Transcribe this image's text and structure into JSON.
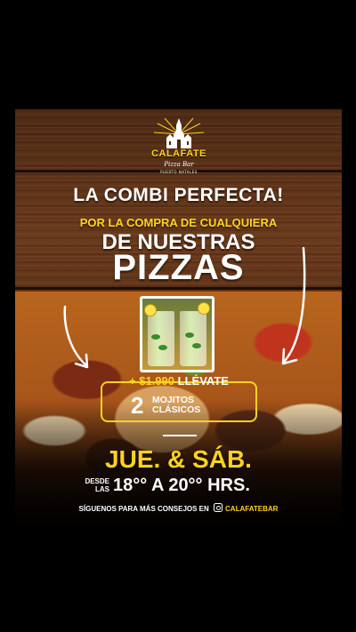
{
  "logo": {
    "brand": "CALAFATE",
    "sub": "Pizza Bar",
    "est": "PUERTO NATALES"
  },
  "headline": {
    "line1": "LA COMBI PERFECTA!",
    "line2": "POR LA COMPRA DE CUALQUIERA",
    "line3": "DE NUESTRAS",
    "line4": "PIZZAS"
  },
  "offer": {
    "price": "+ $1.990",
    "llevate": "LLÉVATE",
    "quantity": "2",
    "item_line1": "MOJITOS",
    "item_line2": "CLÁSICOS"
  },
  "schedule": {
    "days": "JUE. & SÁB.",
    "desde_line1": "DESDE",
    "desde_line2": "LAS",
    "time": "18°° A 20°° HRS."
  },
  "footer": {
    "text": "SÍGUENOS PARA MÁS CONSEJOS EN",
    "handle": "CALAFATEBAR"
  },
  "colors": {
    "accent": "#ffd21f",
    "text": "#ffffff",
    "background": "#000000"
  },
  "icons": [
    "instagram-icon",
    "church-logo-icon",
    "arrow-icon"
  ]
}
